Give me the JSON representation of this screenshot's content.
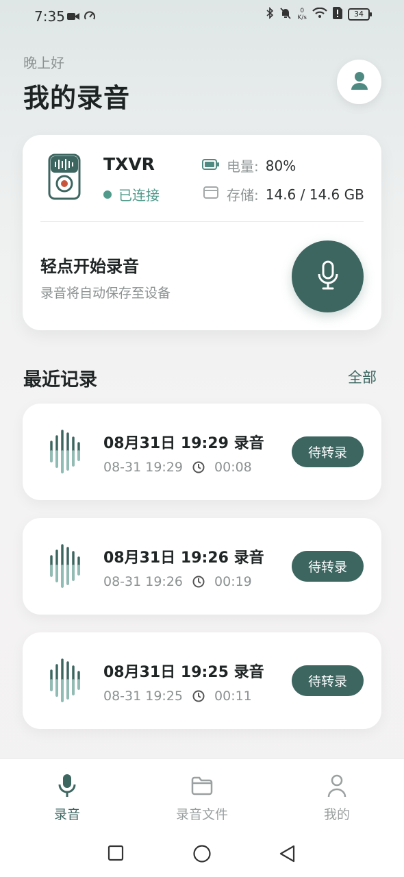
{
  "status_bar": {
    "time": "7:35",
    "net_speed_value": "0",
    "net_speed_unit": "K/s",
    "battery": "34"
  },
  "header": {
    "greeting": "晚上好",
    "title": "我的录音"
  },
  "device": {
    "name": "TXVR",
    "status": "已连接",
    "battery_label": "电量:",
    "battery_value": "80%",
    "storage_label": "存储:",
    "storage_value": "14.6 / 14.6 GB",
    "record_prompt": "轻点开始录音",
    "record_hint": "录音将自动保存至设备"
  },
  "recent": {
    "title": "最近记录",
    "view_all": "全部",
    "items": [
      {
        "title": "08月31日 19:29 录音",
        "date": "08-31 19:29",
        "duration": "00:08",
        "action": "待转录"
      },
      {
        "title": "08月31日 19:26 录音",
        "date": "08-31 19:26",
        "duration": "00:19",
        "action": "待转录"
      },
      {
        "title": "08月31日 19:25 录音",
        "date": "08-31 19:25",
        "duration": "00:11",
        "action": "待转录"
      }
    ]
  },
  "nav": {
    "items": [
      {
        "label": "录音",
        "icon": "mic-icon",
        "active": true
      },
      {
        "label": "录音文件",
        "icon": "folder-icon",
        "active": false
      },
      {
        "label": "我的",
        "icon": "person-icon",
        "active": false
      }
    ]
  },
  "colors": {
    "accent": "#3d6661",
    "connected": "#4f9a8a",
    "wave_light": "#8fbcb4"
  }
}
